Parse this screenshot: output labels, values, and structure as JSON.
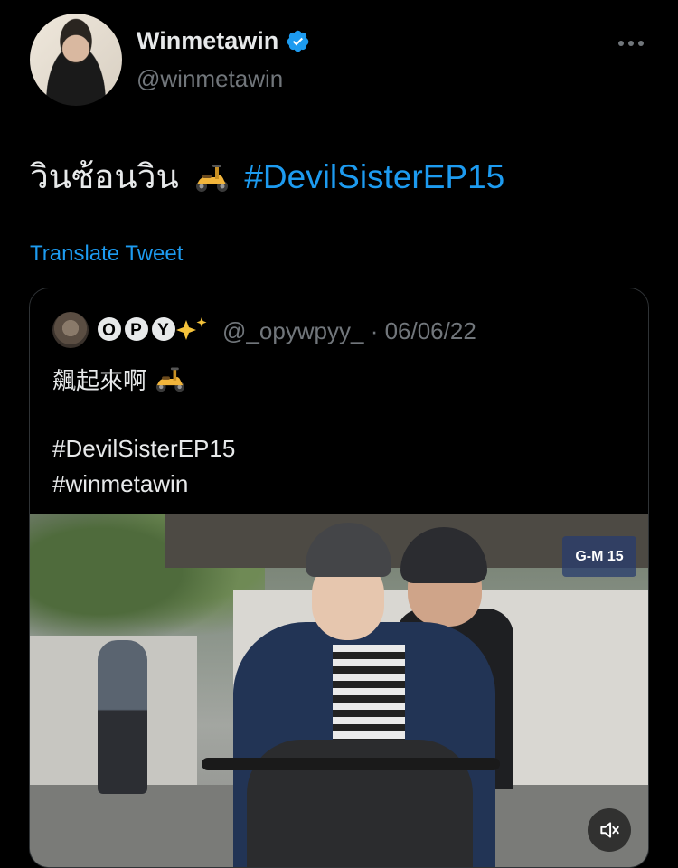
{
  "author": {
    "name": "Winmetawin",
    "handle": "@winmetawin",
    "verified": true
  },
  "tweet": {
    "text": "วินซ้อนวิน",
    "emoji": "motor-scooter",
    "hashtag": "#DevilSisterEP15",
    "translate_label": "Translate Tweet"
  },
  "quoted_tweet": {
    "author_name": "🟤OPY✨",
    "author_name_display": "OPY",
    "handle_and_date": "@_opywpyy_ · 06/06/22",
    "text_line1": "飆起來啊",
    "hashtag1": "#DevilSisterEP15",
    "hashtag2": "#winmetawin",
    "media_logo": "G-M 15"
  },
  "colors": {
    "background": "#000000",
    "text": "#e7e9ea",
    "muted": "#71767b",
    "link": "#1d9bf0",
    "border": "#2f3336"
  }
}
